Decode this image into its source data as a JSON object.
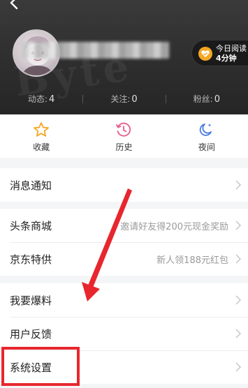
{
  "header": {
    "back_icon": "chevron-left-icon",
    "watermark": "Byte",
    "read_badge": {
      "line1": "今日阅读",
      "line2": "4分钟",
      "icon": "reading-heart-icon",
      "icon_color": "#f5a623"
    },
    "stats": [
      {
        "label": "动态:",
        "value": "4"
      },
      {
        "label": "关注:",
        "value": "0"
      },
      {
        "label": "粉丝:",
        "value": "0"
      }
    ]
  },
  "quick_actions": [
    {
      "label": "收藏",
      "icon": "star-icon",
      "color": "#f5a623"
    },
    {
      "label": "历史",
      "icon": "history-clock-icon",
      "color": "#e85a8a"
    },
    {
      "label": "夜间",
      "icon": "night-moon-icon",
      "color": "#4a7be0"
    }
  ],
  "menu_groups": [
    {
      "items": [
        {
          "label": "消息通知",
          "value": ""
        }
      ]
    },
    {
      "items": [
        {
          "label": "头条商城",
          "value": "邀请好友得200元现金奖励"
        },
        {
          "label": "京东特供",
          "value": "新人领188元红包"
        }
      ]
    },
    {
      "items": [
        {
          "label": "我要爆料",
          "value": ""
        },
        {
          "label": "用户反馈",
          "value": ""
        },
        {
          "label": "系统设置",
          "value": ""
        }
      ]
    }
  ],
  "annotation": {
    "highlight_color": "#e8262e",
    "target": "系统设置"
  }
}
